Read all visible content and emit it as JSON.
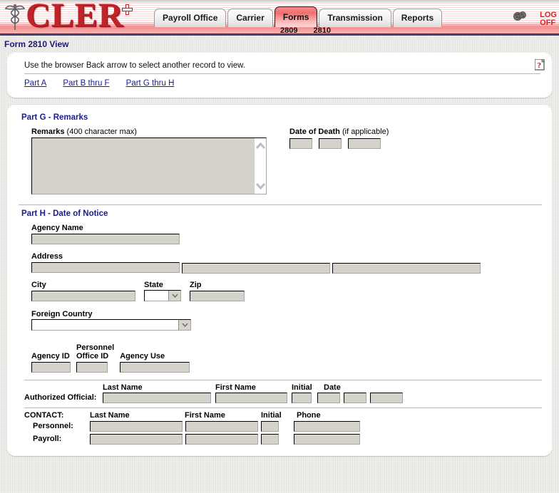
{
  "header": {
    "logo_text": "CLER",
    "logo_icon": "caduceus-icon",
    "tabs": [
      {
        "label": "Payroll Office",
        "active": false
      },
      {
        "label": "Carrier",
        "active": false
      },
      {
        "label": "Forms",
        "active": true
      },
      {
        "label": "Transmission",
        "active": false
      },
      {
        "label": "Reports",
        "active": false
      }
    ],
    "subtabs": [
      {
        "label": "2809"
      },
      {
        "label": "2810"
      }
    ],
    "gear_icon": "gear-icon",
    "logoff_line1": "LOG",
    "logoff_line2": "OFF"
  },
  "page": {
    "title": "Form 2810 View",
    "help_icon": "help-question-icon"
  },
  "instructions": {
    "hint": "Use the browser Back arrow to select another record to view.",
    "links": [
      {
        "label": "Part A"
      },
      {
        "label": "Part B thru F"
      },
      {
        "label": "Part G thru H"
      }
    ]
  },
  "part_g": {
    "title": "Part G - Remarks",
    "remarks_label_strong": "Remarks",
    "remarks_label_soft": "(400 character max)",
    "remarks_value": "",
    "scroll_up_icon": "chevron-up-icon",
    "scroll_down_icon": "chevron-down-icon",
    "date_of_death_label_strong": "Date of Death",
    "date_of_death_label_soft": "(if applicable)",
    "dod_month": "",
    "dod_day": "",
    "dod_year": ""
  },
  "part_h": {
    "title": "Part H - Date of Notice",
    "agency_name_label": "Agency Name",
    "agency_name_value": "",
    "address_label": "Address",
    "address_line1": "",
    "address_line2": "",
    "address_line3": "",
    "city_label": "City",
    "city_value": "",
    "state_label": "State",
    "state_value": "",
    "state_arrow_icon": "chevron-down-icon",
    "zip_label": "Zip",
    "zip_value": "",
    "foreign_country_label": "Foreign Country",
    "foreign_country_value": "",
    "foreign_country_arrow_icon": "chevron-down-icon",
    "agency_id_label": "Agency ID",
    "agency_id_value": "",
    "personnel_office_id_label_line1": "Personnel",
    "personnel_office_id_label_line2": "Office ID",
    "personnel_office_id_value": "",
    "agency_use_label": "Agency Use",
    "agency_use_value": "",
    "official": {
      "last_name_header": "Last Name",
      "first_name_header": "First Name",
      "initial_header": "Initial",
      "date_header": "Date",
      "row_label": "Authorized Official:",
      "last_name_value": "",
      "first_name_value": "",
      "initial_value": "",
      "date_month": "",
      "date_day": "",
      "date_year": ""
    },
    "contact": {
      "section_label": "CONTACT:",
      "last_name_header": "Last Name",
      "first_name_header": "First Name",
      "initial_header": "Initial",
      "phone_header": "Phone",
      "rows": [
        {
          "label": "Personnel:",
          "last_name": "",
          "first_name": "",
          "initial": "",
          "phone": ""
        },
        {
          "label": "Payroll:",
          "last_name": "",
          "first_name": "",
          "initial": "",
          "phone": ""
        }
      ]
    }
  },
  "colors": {
    "brand_red": "#c0232a",
    "link_navy": "#1b1b8e",
    "title_navy": "#1b1b6e",
    "field_gray": "#d4d2cb",
    "active_tab": "#f06e6e"
  }
}
